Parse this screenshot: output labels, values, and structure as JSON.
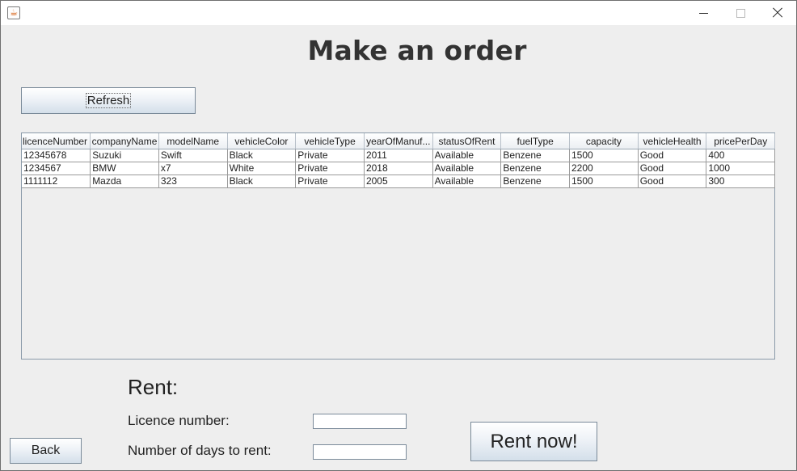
{
  "window": {
    "icon": "java-cup-icon",
    "controls": [
      "minimize-icon",
      "maximize-icon",
      "close-icon"
    ]
  },
  "heading": "Make an order",
  "refresh_label": "Refresh",
  "table": {
    "columns": [
      "licenceNumber",
      "companyName",
      "modelName",
      "vehicleColor",
      "vehicleType",
      "yearOfManuf...",
      "statusOfRent",
      "fuelType",
      "capacity",
      "vehicleHealth",
      "pricePerDay"
    ],
    "rows": [
      [
        "12345678",
        "Suzuki",
        "Swift",
        "Black",
        "Private",
        "2011",
        "Available",
        "Benzene",
        "1500",
        "Good",
        "400"
      ],
      [
        "1234567",
        "BMW",
        "x7",
        "White",
        "Private",
        "2018",
        "Available",
        "Benzene",
        "2200",
        "Good",
        "1000"
      ],
      [
        "1111112",
        "Mazda",
        "323",
        "Black",
        "Private",
        "2005",
        "Available",
        "Benzene",
        "1500",
        "Good",
        "300"
      ]
    ]
  },
  "rent": {
    "title": "Rent:",
    "licence_label": "Licence number:",
    "licence_value": "",
    "days_label": "Number of days to rent:",
    "days_value": ""
  },
  "back_label": "Back",
  "rent_now_label": "Rent now!"
}
